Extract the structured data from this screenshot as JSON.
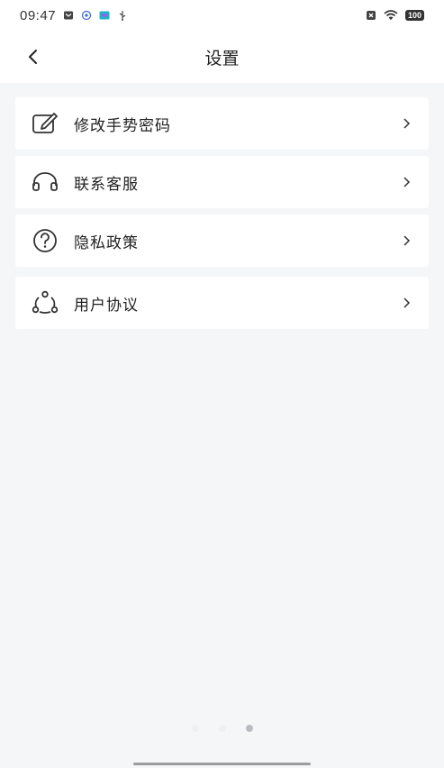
{
  "status_bar": {
    "time": "09:47",
    "battery": "100",
    "icons": [
      "mail-icon",
      "notification-icon",
      "app-icon",
      "usb-icon",
      "sim-icon",
      "wifi-icon"
    ]
  },
  "header": {
    "title": "设置",
    "back_icon": "chevron-left-icon"
  },
  "settings": {
    "items": [
      {
        "label": "修改手势密码",
        "icon": "edit-icon"
      },
      {
        "label": "联系客服",
        "icon": "headset-icon"
      },
      {
        "label": "隐私政策",
        "icon": "question-icon"
      },
      {
        "label": "用户协议",
        "icon": "share-icon"
      }
    ]
  },
  "pager": {
    "total": 3,
    "active_index": 2
  },
  "colors": {
    "background": "#f5f6f8",
    "card": "#ffffff",
    "text": "#222222",
    "icon": "#333333"
  }
}
